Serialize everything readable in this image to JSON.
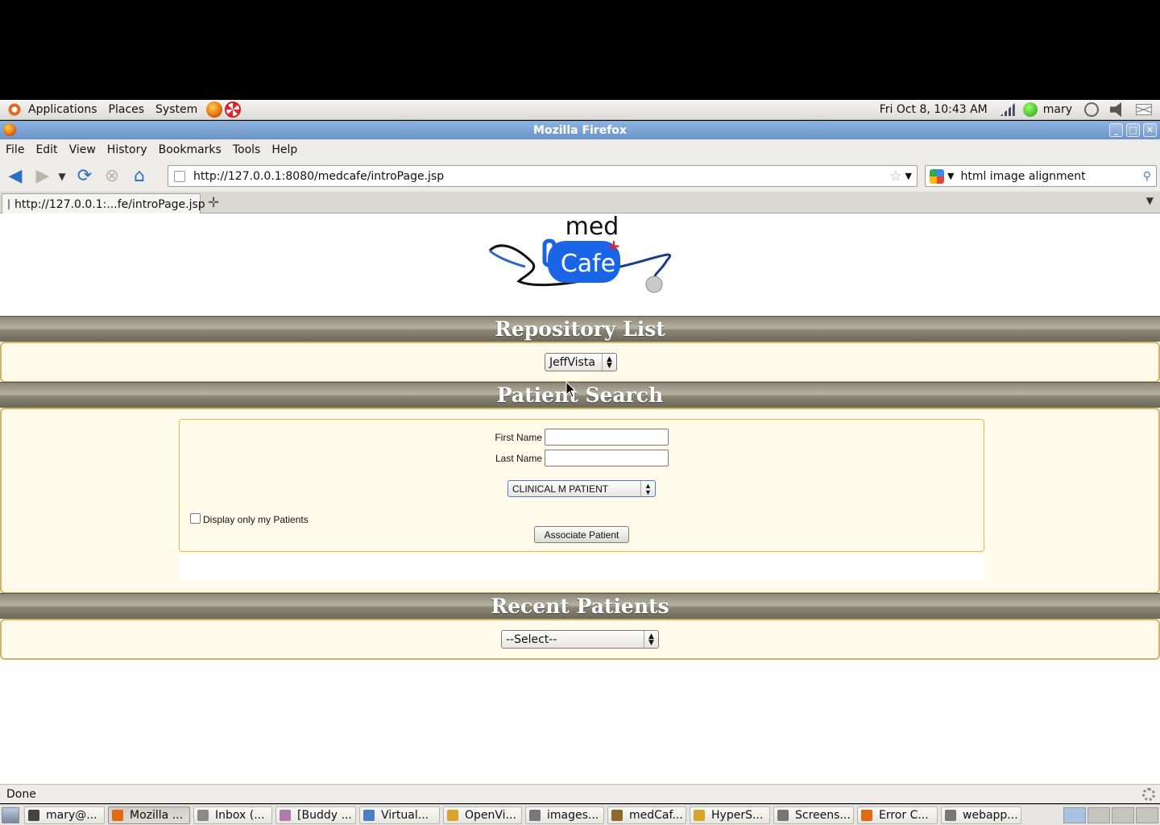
{
  "panel": {
    "menus": [
      "Applications",
      "Places",
      "System"
    ],
    "clock": "Fri Oct  8, 10:43 AM",
    "user": "mary"
  },
  "browser": {
    "title": "Mozilla Firefox",
    "menu": [
      "File",
      "Edit",
      "View",
      "History",
      "Bookmarks",
      "Tools",
      "Help"
    ],
    "url": "http://127.0.0.1:8080/medcafe/introPage.jsp",
    "search_text": "html image alignment",
    "tab_title": "http://127.0.0.1:...fe/introPage.jsp",
    "status": "Done"
  },
  "logo": {
    "line1": "med",
    "line2": "Cafe"
  },
  "repository": {
    "heading": "Repository List",
    "selected": "JeffVista"
  },
  "patient_search": {
    "heading": "Patient Search",
    "first_name_label": "First Name",
    "last_name_label": "Last Name",
    "first_name_value": "",
    "last_name_value": "",
    "patient_select": "CLINICAL M PATIENT",
    "display_only_label": "Display only my Patients",
    "display_only_checked": false,
    "associate_button": "Associate Patient"
  },
  "recent": {
    "heading": "Recent Patients",
    "selected": "--Select--"
  },
  "taskbar": [
    {
      "label": "mary@...",
      "icon": "terminal-icon",
      "color": "#444444",
      "active": false
    },
    {
      "label": "Mozilla ...",
      "icon": "firefox-icon",
      "color": "#e26a12",
      "active": true
    },
    {
      "label": "Inbox (...",
      "icon": "mail-icon",
      "color": "#8a8a8a",
      "active": false
    },
    {
      "label": "[Buddy ...",
      "icon": "chat-icon",
      "color": "#b07ab0",
      "active": false
    },
    {
      "label": "Virtual...",
      "icon": "virtualbox-icon",
      "color": "#4a7ec6",
      "active": false
    },
    {
      "label": "OpenVi...",
      "icon": "openvista-icon",
      "color": "#d9a42a",
      "active": false
    },
    {
      "label": "images...",
      "icon": "window-icon",
      "color": "#777777",
      "active": false
    },
    {
      "label": "medCaf...",
      "icon": "editor-icon",
      "color": "#8d6a2a",
      "active": false
    },
    {
      "label": "HyperS...",
      "icon": "hypersnap-icon",
      "color": "#d9a42a",
      "active": false
    },
    {
      "label": "Screens...",
      "icon": "window-icon",
      "color": "#777777",
      "active": false
    },
    {
      "label": "Error C...",
      "icon": "firefox-icon",
      "color": "#e26a12",
      "active": false
    },
    {
      "label": "webapp...",
      "icon": "window-icon",
      "color": "#777777",
      "active": false
    }
  ]
}
